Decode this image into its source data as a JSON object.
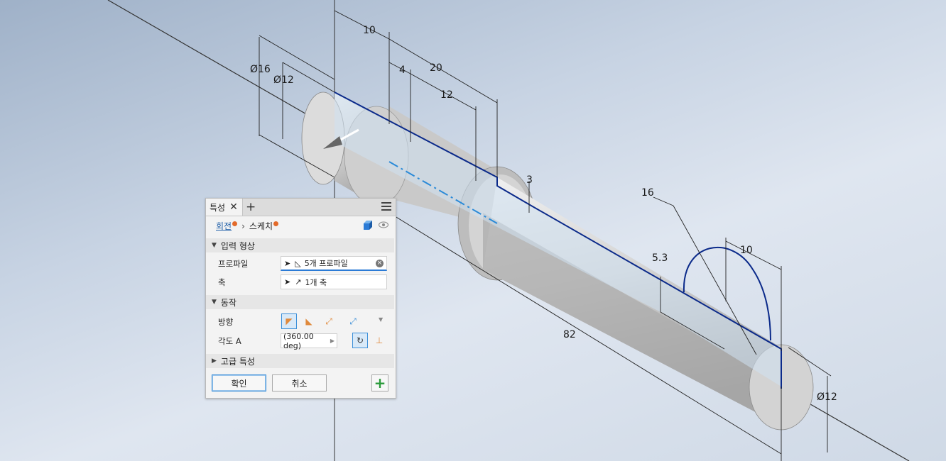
{
  "dimensions": {
    "d10_top": "10",
    "d20": "20",
    "d4": "4",
    "d12_top": "12",
    "dia16": "Ø16",
    "dia12_left": "Ø12",
    "d3": "3",
    "d16": "16",
    "d10_right": "10",
    "d5_3": "5.3",
    "d82": "82",
    "dia12_right": "Ø12"
  },
  "panel": {
    "tab_label": "특성",
    "breadcrumb": {
      "feature": "회전",
      "sketch": "스케치"
    },
    "sections": {
      "input_geometry": "입력 형상",
      "behavior": "동작",
      "advanced": "고급 특성"
    },
    "profile": {
      "label": "프로파일",
      "value": "5개 프로파일"
    },
    "axis": {
      "label": "축",
      "value": "1개 축"
    },
    "direction": {
      "label": "방향"
    },
    "angle": {
      "label": "각도 A",
      "value": "(360.00 deg)"
    },
    "buttons": {
      "ok": "확인",
      "cancel": "취소"
    }
  },
  "colors": {
    "accent": "#2b7bd6",
    "sketch_line": "#0b2a8a",
    "preview_orange": "#e08a3c",
    "add_green": "#2a9a3a"
  }
}
